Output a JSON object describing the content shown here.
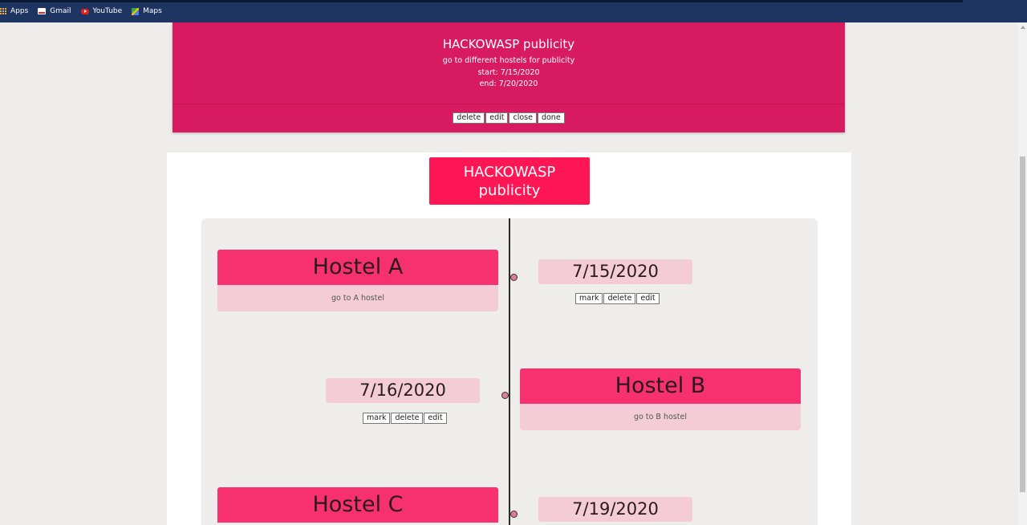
{
  "bookmarks": [
    {
      "label": "Apps",
      "icon": "apps-icon"
    },
    {
      "label": "Gmail",
      "icon": "gmail-icon"
    },
    {
      "label": "YouTube",
      "icon": "youtube-icon"
    },
    {
      "label": "Maps",
      "icon": "maps-icon"
    }
  ],
  "task": {
    "title": "HACKOWASP publicity",
    "description": "go to different hostels for publicity",
    "start": "start: 7/15/2020",
    "end": "end: 7/20/2020",
    "buttons": {
      "delete": "delete",
      "edit": "edit",
      "close": "close",
      "done": "done"
    }
  },
  "timeline": {
    "title_line1": "HACKOWASP",
    "title_line2": "publicity",
    "events": [
      {
        "name": "Hostel A",
        "description": "go to A hostel",
        "date": "7/15/2020",
        "mark": "mark",
        "delete": "delete",
        "edit": "edit"
      },
      {
        "name": "Hostel B",
        "description": "go to B hostel",
        "date": "7/16/2020",
        "mark": "mark",
        "delete": "delete",
        "edit": "edit"
      },
      {
        "name": "Hostel C",
        "date": "7/19/2020"
      }
    ]
  },
  "colors": {
    "topcard": "#d81b60",
    "title_box": "#ff1654",
    "event_head": "#f7306f",
    "event_body": "#f3ccd8"
  }
}
